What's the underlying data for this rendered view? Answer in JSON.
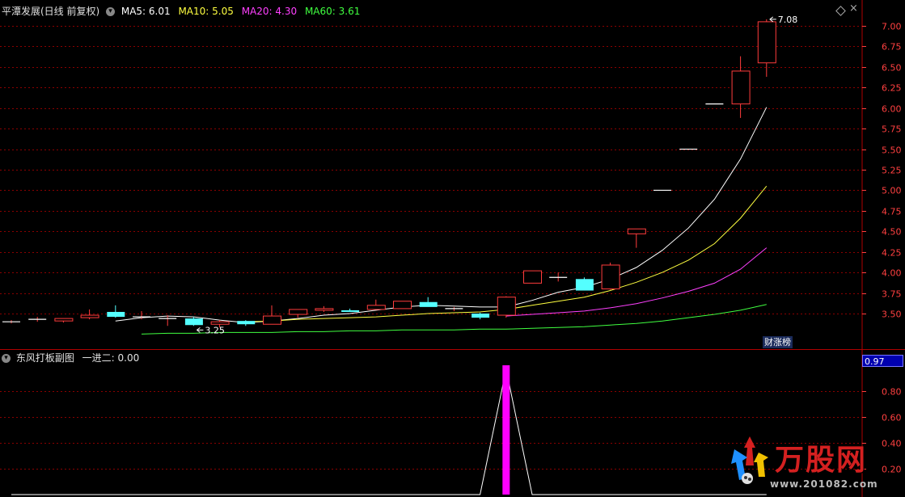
{
  "header": {
    "title": "平潭发展(日线 前复权)",
    "ma5": "MA5: 6.01",
    "ma10": "MA10: 5.05",
    "ma20": "MA20: 4.30",
    "ma60": "MA60: 3.61"
  },
  "sub_header": {
    "title": "东风打板副图",
    "indicator": "一进二: 0.00"
  },
  "badge": "财涨榜",
  "watermark": {
    "brand": "万股网",
    "url": "www.201082.com"
  },
  "colors": {
    "up": "#ff3c3c",
    "down": "#54ffff",
    "ma5": "#ffffff",
    "ma10": "#ffff40",
    "ma20": "#ff40ff",
    "ma60": "#40ff40",
    "grid": "#8b0000",
    "axis": "#ff4040",
    "bar": "#ff00ff"
  },
  "chart_data": [
    {
      "type": "candlestick",
      "ylim": [
        3.25,
        7.15
      ],
      "yticks": [
        3.5,
        3.75,
        4.0,
        4.25,
        4.5,
        4.75,
        5.0,
        5.25,
        5.5,
        5.75,
        6.0,
        6.25,
        6.5,
        6.75,
        7.0
      ],
      "ytick_labels": [
        "3.50",
        "3.75",
        "4.00",
        "4.25",
        "4.50",
        "4.75",
        "5.00",
        "5.25",
        "5.50",
        "5.75",
        "6.00",
        "6.25",
        "6.50",
        "6.75",
        "7.00"
      ],
      "candles": [
        {
          "o": 3.4,
          "h": 3.42,
          "l": 3.38,
          "c": 3.4
        },
        {
          "o": 3.43,
          "h": 3.46,
          "l": 3.4,
          "c": 3.43
        },
        {
          "o": 3.41,
          "h": 3.44,
          "l": 3.39,
          "c": 3.44
        },
        {
          "o": 3.45,
          "h": 3.55,
          "l": 3.43,
          "c": 3.48
        },
        {
          "o": 3.52,
          "h": 3.6,
          "l": 3.45,
          "c": 3.46
        },
        {
          "o": 3.46,
          "h": 3.53,
          "l": 3.43,
          "c": 3.46
        },
        {
          "o": 3.44,
          "h": 3.48,
          "l": 3.35,
          "c": 3.44
        },
        {
          "o": 3.44,
          "h": 3.46,
          "l": 3.35,
          "c": 3.36
        },
        {
          "o": 3.37,
          "h": 3.42,
          "l": 3.33,
          "c": 3.4
        },
        {
          "o": 3.41,
          "h": 3.42,
          "l": 3.35,
          "c": 3.37
        },
        {
          "o": 3.37,
          "h": 3.6,
          "l": 3.37,
          "c": 3.47
        },
        {
          "o": 3.49,
          "h": 3.55,
          "l": 3.45,
          "c": 3.55
        },
        {
          "o": 3.54,
          "h": 3.59,
          "l": 3.52,
          "c": 3.56
        },
        {
          "o": 3.54,
          "h": 3.56,
          "l": 3.52,
          "c": 3.52
        },
        {
          "o": 3.55,
          "h": 3.67,
          "l": 3.55,
          "c": 3.6
        },
        {
          "o": 3.56,
          "h": 3.65,
          "l": 3.56,
          "c": 3.65
        },
        {
          "o": 3.64,
          "h": 3.7,
          "l": 3.59,
          "c": 3.58
        },
        {
          "o": 3.56,
          "h": 3.58,
          "l": 3.53,
          "c": 3.56
        },
        {
          "o": 3.5,
          "h": 3.51,
          "l": 3.43,
          "c": 3.45
        },
        {
          "o": 3.48,
          "h": 3.71,
          "l": 3.45,
          "c": 3.7
        },
        {
          "o": 3.87,
          "h": 4.02,
          "l": 3.87,
          "c": 4.02
        },
        {
          "o": 3.94,
          "h": 4.0,
          "l": 3.89,
          "c": 3.94
        },
        {
          "o": 3.92,
          "h": 3.94,
          "l": 3.78,
          "c": 3.78
        },
        {
          "o": 3.8,
          "h": 4.12,
          "l": 3.79,
          "c": 4.09
        },
        {
          "o": 4.47,
          "h": 4.53,
          "l": 4.3,
          "c": 4.53
        },
        {
          "o": 5.0,
          "h": 5.0,
          "l": 5.0,
          "c": 5.0
        },
        {
          "o": 5.5,
          "h": 5.5,
          "l": 5.5,
          "c": 5.5
        },
        {
          "o": 6.05,
          "h": 6.05,
          "l": 6.05,
          "c": 6.05
        },
        {
          "o": 6.05,
          "h": 6.63,
          "l": 5.88,
          "c": 6.45
        },
        {
          "o": 6.55,
          "h": 7.08,
          "l": 6.38,
          "c": 7.05
        }
      ],
      "series": [
        {
          "name": "MA5",
          "values": [
            null,
            null,
            null,
            null,
            3.41,
            3.45,
            3.47,
            3.46,
            3.42,
            3.39,
            3.41,
            3.44,
            3.48,
            3.5,
            3.54,
            3.58,
            3.6,
            3.59,
            3.58,
            3.58,
            3.66,
            3.76,
            3.82,
            3.92,
            4.06,
            4.27,
            4.54,
            4.89,
            5.38,
            6.01
          ]
        },
        {
          "name": "MA10",
          "values": [
            null,
            null,
            null,
            null,
            null,
            null,
            null,
            null,
            null,
            3.4,
            3.41,
            3.43,
            3.44,
            3.45,
            3.46,
            3.48,
            3.5,
            3.51,
            3.52,
            3.55,
            3.6,
            3.65,
            3.7,
            3.78,
            3.88,
            4.0,
            4.15,
            4.35,
            4.66,
            5.05
          ]
        },
        {
          "name": "MA20",
          "values": [
            null,
            null,
            null,
            null,
            null,
            null,
            null,
            null,
            null,
            null,
            null,
            null,
            null,
            null,
            null,
            null,
            null,
            null,
            null,
            3.47,
            3.49,
            3.51,
            3.53,
            3.57,
            3.62,
            3.69,
            3.77,
            3.87,
            4.04,
            4.3
          ]
        },
        {
          "name": "MA60",
          "values": [
            null,
            null,
            null,
            null,
            null,
            3.25,
            3.26,
            3.26,
            3.27,
            3.27,
            3.27,
            3.28,
            3.28,
            3.29,
            3.29,
            3.3,
            3.3,
            3.3,
            3.31,
            3.31,
            3.32,
            3.33,
            3.34,
            3.36,
            3.38,
            3.41,
            3.45,
            3.49,
            3.54,
            3.61
          ]
        }
      ],
      "annotations": [
        {
          "label": "3.25",
          "index": 7,
          "y": 3.3
        },
        {
          "label": "7.08",
          "index": 29,
          "y": 7.08
        }
      ]
    },
    {
      "type": "bar",
      "title": "东风打板副图",
      "ylim": [
        0,
        1.0
      ],
      "yticks": [
        0.2,
        0.4,
        0.6,
        0.8
      ],
      "ytick_labels": [
        "0.20",
        "0.40",
        "0.60",
        "0.80"
      ],
      "current_value": "0.97",
      "bars": [
        {
          "index": 19,
          "value": 1.0
        }
      ],
      "line": {
        "name": "一进二",
        "values": [
          0,
          0,
          0,
          0,
          0,
          0,
          0,
          0,
          0,
          0,
          0,
          0,
          0,
          0,
          0,
          0,
          0,
          0,
          0,
          0.97,
          0,
          0,
          0,
          0,
          0,
          0,
          0,
          0,
          0,
          0
        ]
      }
    }
  ]
}
